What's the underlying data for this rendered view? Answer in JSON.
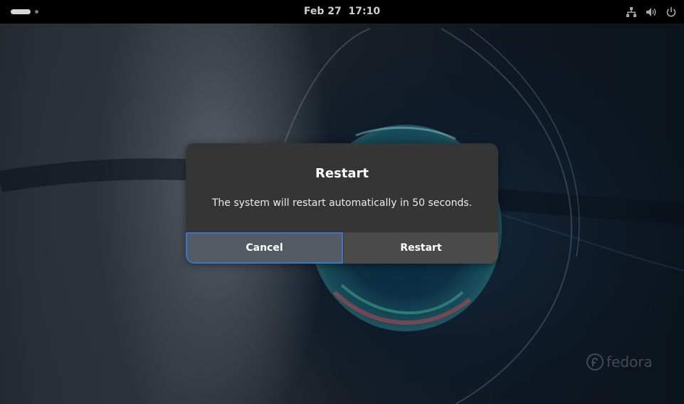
{
  "top_bar": {
    "clock": "Feb 27  17:10",
    "icons": [
      "activities-indicator",
      "workspace-dot",
      "network-icon",
      "volume-icon",
      "power-icon"
    ]
  },
  "dialog": {
    "title": "Restart",
    "message": "The system will restart automatically in 50 seconds.",
    "cancel_label": "Cancel",
    "restart_label": "Restart"
  },
  "wallpaper": {
    "watermark": "fedora"
  },
  "colors": {
    "focus_ring": "#3c77c4",
    "dialog_bg": "#353535",
    "top_bar_bg": "#000000"
  }
}
